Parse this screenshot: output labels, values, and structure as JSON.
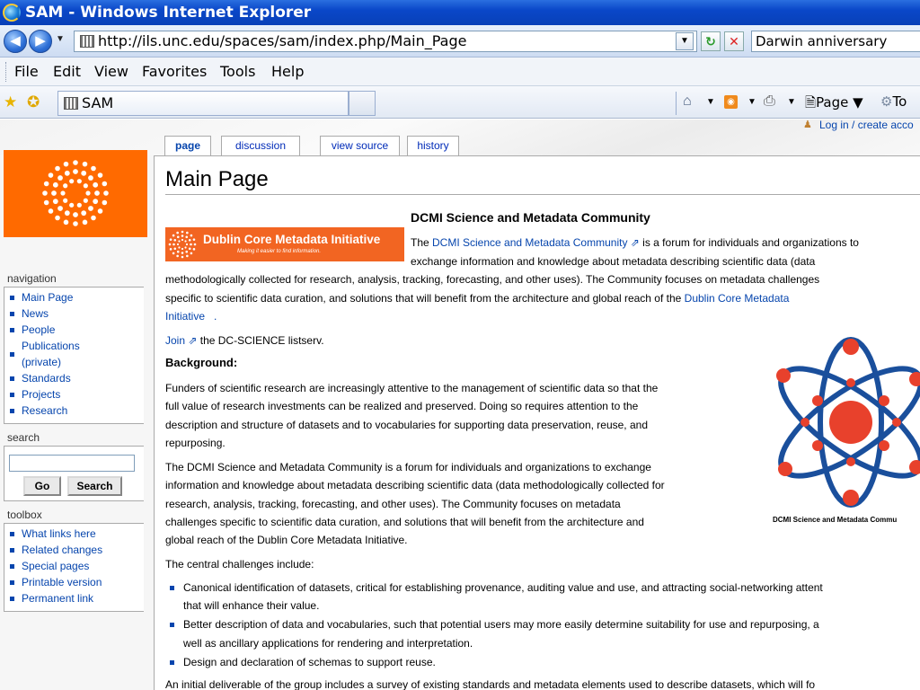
{
  "window": {
    "title": "SAM - Windows Internet Explorer"
  },
  "address": {
    "url": "http://ils.unc.edu/spaces/sam/index.php/Main_Page",
    "search_value": "Darwin anniversary"
  },
  "menu": [
    "File",
    "Edit",
    "View",
    "Favorites",
    "Tools",
    "Help"
  ],
  "favbar": {
    "tab_label": "SAM",
    "page_menu": "Page",
    "tools_menu": "To"
  },
  "wiki": {
    "login": "Log in / create acco",
    "tabs": [
      "page",
      "discussion",
      "view source",
      "history"
    ],
    "heading": "Main Page",
    "nav_header": "navigation",
    "nav_items": [
      "Main Page",
      "News",
      "People",
      "Publications",
      "(private)",
      "Standards",
      "Projects",
      "Research"
    ],
    "search_header": "search",
    "go_label": "Go",
    "search_label": "Search",
    "toolbox_header": "toolbox",
    "toolbox_items": [
      "What links here",
      "Related changes",
      "Special pages",
      "Printable version",
      "Permanent link"
    ]
  },
  "article": {
    "dc_title": "DCMI Science and Metadata Community",
    "dc_banner_text": "Dublin Core Metadata Initiative",
    "dc_banner_tagline": "Making it easier to find information.",
    "p1_pre": "The ",
    "p1_link": "DCMI Science and Metadata Community",
    "p1_post": " is a forum for individuals and organizations to",
    "p1_l2": "exchange information and knowledge about metadata describing scientific data (data",
    "p1_l3": "methodologically collected for research, analysis, tracking, forecasting, and other uses). The Community focuses on metadata challenges",
    "p1_l4_pre": "specific to scientific data curation, and solutions that will benefit from the architecture and global reach of the ",
    "p1_l4_link": "Dublin Core Metadata",
    "p1_l5_link": "Initiative",
    "p1_l5_post": ".",
    "join_link": "Join",
    "join_post": " the DC-SCIENCE listserv.",
    "background_head": "Background:",
    "bg_lines": [
      "Funders of scientific research are increasingly attentive to the management of scientific data so that the",
      "full value of research investments can be realized and preserved. Doing so requires attention to the",
      "description and structure of datasets and to vocabularies for supporting data preservation, reuse, and",
      "repurposing."
    ],
    "p2_lines": [
      "The DCMI Science and Metadata Community is a forum for individuals and organizations to exchange",
      "information and knowledge about metadata describing scientific data (data methodologically collected for",
      "research, analysis, tracking, forecasting, and other uses). The Community focuses on metadata",
      "challenges specific to scientific data curation, and solutions that will benefit from the architecture and",
      "global reach of the Dublin Core Metadata Initiative."
    ],
    "challenges_intro": "The central challenges include:",
    "challenges": [
      [
        "Canonical identification of datasets, critical for establishing provenance, auditing value and use, and attracting social-networking attent",
        "that will enhance their value."
      ],
      [
        "Better description of data and vocabularies, such that potential users may more easily determine suitability for use and repurposing, a",
        "well as ancillary applications for rendering and interpretation."
      ],
      [
        "Design and declaration of schemas to support reuse."
      ]
    ],
    "last_line": "An initial deliverable of the group includes a survey of existing standards and metadata elements used to describe datasets, which will fo",
    "figure_caption": "DCMI Science and Metadata Commu"
  },
  "colors": {
    "link": "#0645ad",
    "dcmi_orange": "#ff6a00",
    "atom_red": "#e8412c",
    "atom_blue": "#1a4f9c"
  }
}
